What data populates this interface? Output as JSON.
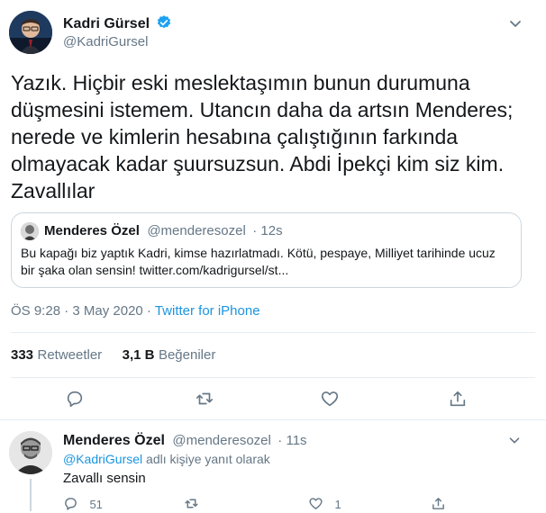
{
  "main_tweet": {
    "author_name": "Kadri Gürsel",
    "author_handle": "@KadriGursel",
    "text": "Yazık. Hiçbir eski meslektaşımın bunun durumuna düşmesini istemem. Utancın daha da artsın Menderes; nerede ve kimlerin hesabına çalıştığının farkında olmayacak kadar şuursuzsun. Abdi İpekçi kim siz kim. Zavallılar",
    "timestamp": "ÖS 9:28 · 3 May 2020",
    "separator": " · ",
    "source": "Twitter for iPhone",
    "retweets_count": "333",
    "retweets_label": "Retweetler",
    "likes_count": "3,1 B",
    "likes_label": "Beğeniler"
  },
  "quoted_tweet": {
    "author_name": "Menderes Özel",
    "author_handle": "@menderesozel",
    "time": "· 12s",
    "text": "Bu kapağı biz yaptık Kadri, kimse hazırlatmadı. Kötü, pespaye, Milliyet tarihinde ucuz bir şaka olan sensin! twitter.com/kadrigursel/st..."
  },
  "reply_tweet": {
    "author_name": "Menderes Özel",
    "author_handle": "@menderesozel",
    "time": "· 11s",
    "replying_to_handle": "@KadriGursel",
    "replying_to_suffix": "adlı kişiye yanıt olarak",
    "text": "Zavallı sensin",
    "reply_count": "51",
    "like_count": "1"
  },
  "colors": {
    "accent": "#1b95e0",
    "muted": "#657786",
    "border": "#e6ecf0",
    "verified": "#1da1f2"
  },
  "icons": {
    "verified": "verified-badge-icon",
    "caret": "chevron-down-icon",
    "reply": "reply-icon",
    "retweet": "retweet-icon",
    "like": "heart-icon",
    "share": "share-icon"
  }
}
